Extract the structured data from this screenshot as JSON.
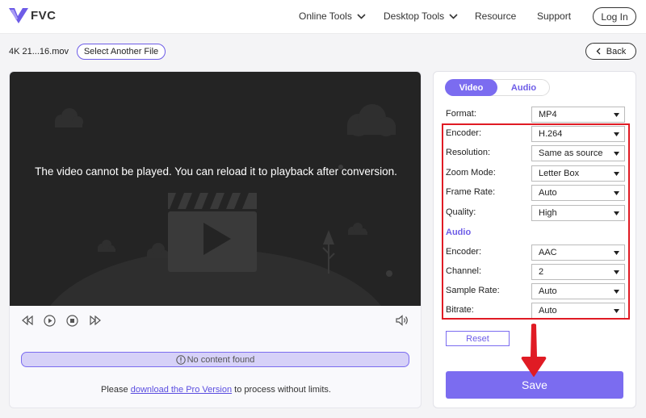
{
  "header": {
    "logo_text": "FVC",
    "nav": [
      {
        "label": "Online Tools",
        "has_dropdown": true
      },
      {
        "label": "Desktop Tools",
        "has_dropdown": true
      },
      {
        "label": "Resource",
        "has_dropdown": false
      },
      {
        "label": "Support",
        "has_dropdown": false
      }
    ],
    "login_label": "Log In"
  },
  "toolbar": {
    "file_name": "4K 21...16.mov",
    "select_file_label": "Select Another File",
    "back_label": "Back"
  },
  "player": {
    "message": "The video cannot be played. You can reload it to playback after conversion.",
    "progress_text": "No content found"
  },
  "promo": {
    "prefix": "Please ",
    "link": "download the Pro Version",
    "suffix": " to process without limits."
  },
  "settings": {
    "tabs": [
      {
        "label": "Video",
        "active": true
      },
      {
        "label": "Audio",
        "active": false
      }
    ],
    "format": {
      "label": "Format:",
      "value": "MP4"
    },
    "video_rows": [
      {
        "label": "Encoder:",
        "value": "H.264"
      },
      {
        "label": "Resolution:",
        "value": "Same as source"
      },
      {
        "label": "Zoom Mode:",
        "value": "Letter Box"
      },
      {
        "label": "Frame Rate:",
        "value": "Auto"
      },
      {
        "label": "Quality:",
        "value": "High"
      }
    ],
    "audio_heading": "Audio",
    "audio_rows": [
      {
        "label": "Encoder:",
        "value": "AAC"
      },
      {
        "label": "Channel:",
        "value": "2"
      },
      {
        "label": "Sample Rate:",
        "value": "Auto"
      },
      {
        "label": "Bitrate:",
        "value": "Auto"
      }
    ],
    "reset_label": "Reset",
    "save_label": "Save"
  },
  "colors": {
    "accent": "#7b6cf0",
    "highlight": "#e01b24",
    "video_bg": "#242424"
  }
}
